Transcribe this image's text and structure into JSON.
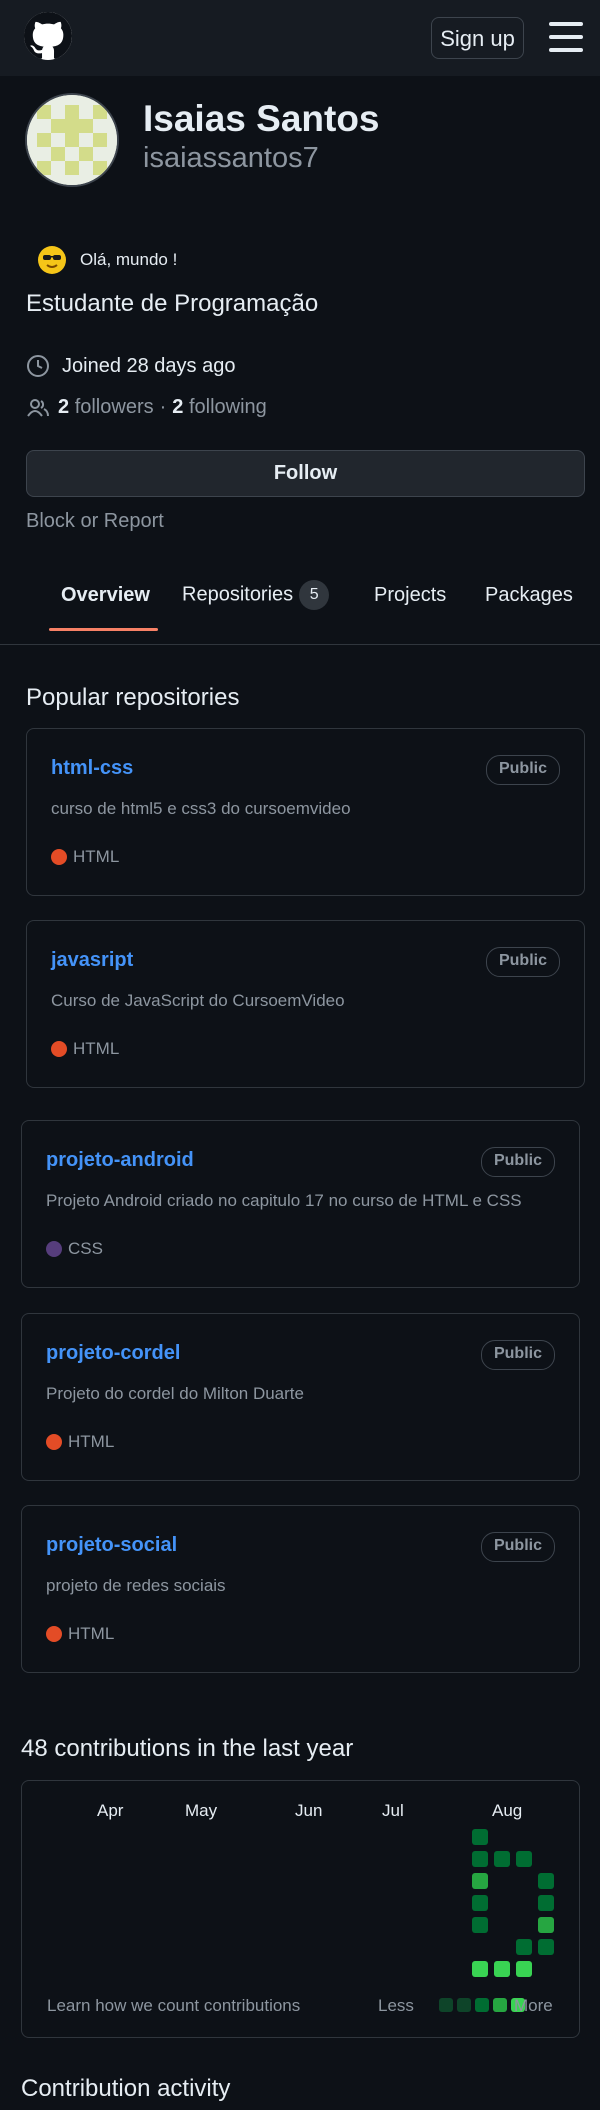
{
  "header": {
    "signup_label": "Sign up"
  },
  "profile": {
    "name": "Isaias Santos",
    "login": "isaiassantos7",
    "status_text": "Olá, mundo !",
    "bio": "Estudante de Programação",
    "joined": "Joined 28 days ago",
    "followers_count": "2",
    "followers_label": "followers",
    "separator": "·",
    "following_count": "2",
    "following_label": "following",
    "follow_button": "Follow",
    "block_report": "Block or Report"
  },
  "tabs": [
    {
      "label": "Overview",
      "active": true
    },
    {
      "label": "Repositories",
      "count": "5"
    },
    {
      "label": "Projects"
    },
    {
      "label": "Packages"
    }
  ],
  "popular": {
    "title": "Popular repositories",
    "repos": [
      {
        "name": "html-css",
        "visibility": "Public",
        "description": "curso de html5 e css3 do cursoemvideo",
        "language": "HTML",
        "lang_color": "#e34c26"
      },
      {
        "name": "javasript",
        "visibility": "Public",
        "description": "Curso de JavaScript do CursoemVideo",
        "language": "HTML",
        "lang_color": "#e34c26"
      },
      {
        "name": "projeto-android",
        "visibility": "Public",
        "description": "Projeto Android criado no capitulo 17 no curso de HTML e CSS",
        "language": "CSS",
        "lang_color": "#563d7c"
      },
      {
        "name": "projeto-cordel",
        "visibility": "Public",
        "description": "Projeto do cordel do Milton Duarte",
        "language": "HTML",
        "lang_color": "#e34c26"
      },
      {
        "name": "projeto-social",
        "visibility": "Public",
        "description": "projeto de redes sociais",
        "language": "HTML",
        "lang_color": "#e34c26"
      }
    ]
  },
  "contributions": {
    "title": "48 contributions in the last year",
    "months": [
      "Apr",
      "May",
      "Jun",
      "Jul",
      "Aug"
    ],
    "learn_link": "Learn how we count contributions",
    "less": "Less",
    "more": "More",
    "level_colors": [
      "#161b22",
      "#0e4429",
      "#006d32",
      "#26a641",
      "#39d353"
    ],
    "grid_levels": [
      [
        2,
        2,
        3,
        2,
        2,
        0,
        4
      ],
      [
        0,
        2,
        0,
        0,
        0,
        0,
        4
      ],
      [
        0,
        2,
        0,
        0,
        0,
        2,
        4
      ],
      [
        0,
        0,
        2,
        2,
        3,
        2,
        0
      ]
    ]
  },
  "activity": {
    "title": "Contribution activity"
  }
}
